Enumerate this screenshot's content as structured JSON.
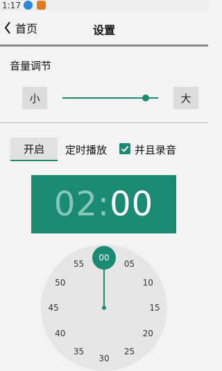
{
  "status_bar": {
    "time": "1:17"
  },
  "nav": {
    "back_label": "首页",
    "title": "设置"
  },
  "volume": {
    "title": "音量调节",
    "minus_label": "小",
    "plus_label": "大",
    "level": 0.87
  },
  "timer": {
    "toggle_label": "开启",
    "label": "定时播放",
    "record_checked": true,
    "record_label": "并且录音",
    "display_hours": "02",
    "display_sep": ":",
    "display_minutes": "00"
  },
  "dial": {
    "selected": "00",
    "labels": [
      "05",
      "10",
      "15",
      "20",
      "25",
      "30",
      "35",
      "40",
      "45",
      "50",
      "55"
    ]
  },
  "colors": {
    "accent": "#1b8a72"
  }
}
